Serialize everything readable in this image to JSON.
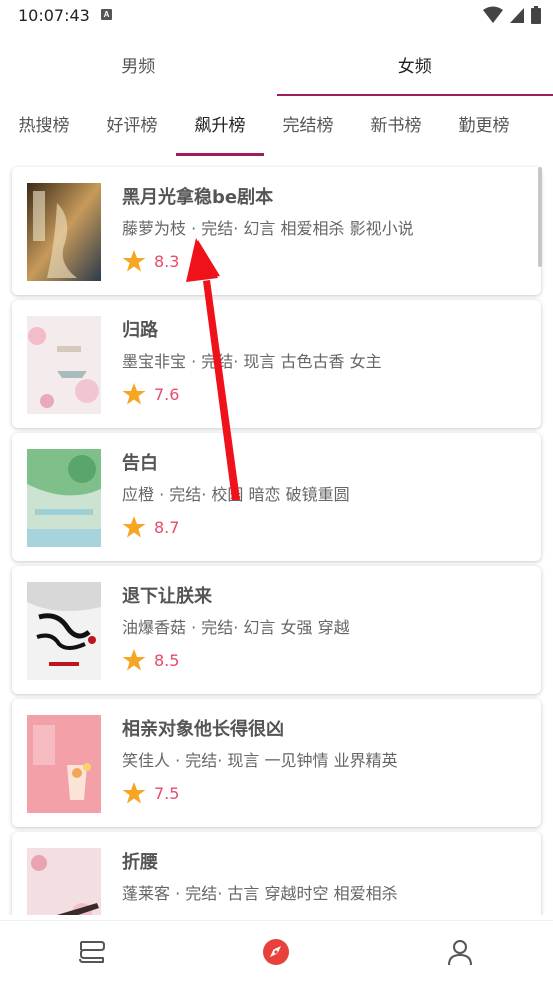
{
  "status_bar": {
    "time": "10:07:43",
    "indicator": "A",
    "icons": [
      "wifi-icon",
      "signal-icon",
      "battery-icon"
    ]
  },
  "gender_tabs": [
    {
      "label": "男频",
      "active": false
    },
    {
      "label": "女频",
      "active": true
    }
  ],
  "rank_tabs": [
    {
      "label": "热搜榜",
      "active": false
    },
    {
      "label": "好评榜",
      "active": false
    },
    {
      "label": "飙升榜",
      "active": true
    },
    {
      "label": "完结榜",
      "active": false
    },
    {
      "label": "新书榜",
      "active": false
    },
    {
      "label": "勤更榜",
      "active": false
    }
  ],
  "books": [
    {
      "title": "黑月光拿稳be剧本",
      "meta": "藤萝为枝 · 完结· 幻言 相爱相杀 影视小说",
      "rating": "8.3",
      "cover_icon": "book-cover-icon"
    },
    {
      "title": "归路",
      "meta": "墨宝非宝 · 完结· 现言 古色古香 女主",
      "rating": "7.6",
      "cover_icon": "book-cover-icon"
    },
    {
      "title": "告白",
      "meta": "应橙 · 完结· 校园 暗恋 破镜重圆",
      "rating": "8.7",
      "cover_icon": "book-cover-icon"
    },
    {
      "title": "退下让朕来",
      "meta": "油爆香菇 · 完结· 幻言 女强 穿越",
      "rating": "8.5",
      "cover_icon": "book-cover-icon"
    },
    {
      "title": "相亲对象他长得很凶",
      "meta": "笑佳人 · 完结· 现言 一见钟情 业界精英",
      "rating": "7.5",
      "cover_icon": "book-cover-icon"
    },
    {
      "title": "折腰",
      "meta": "蓬莱客 · 完结· 古言 穿越时空 相爱相杀",
      "rating": "",
      "cover_icon": "book-cover-icon"
    }
  ],
  "bottom_nav": [
    {
      "icon": "bookshelf-icon",
      "active": false
    },
    {
      "icon": "compass-icon",
      "active": true
    },
    {
      "icon": "user-icon",
      "active": false
    }
  ],
  "colors": {
    "accent": "#9c1f5b",
    "rating": "#e84b6a",
    "star": "#f5a623",
    "compass": "#e8403a",
    "arrow": "#f0121a"
  }
}
